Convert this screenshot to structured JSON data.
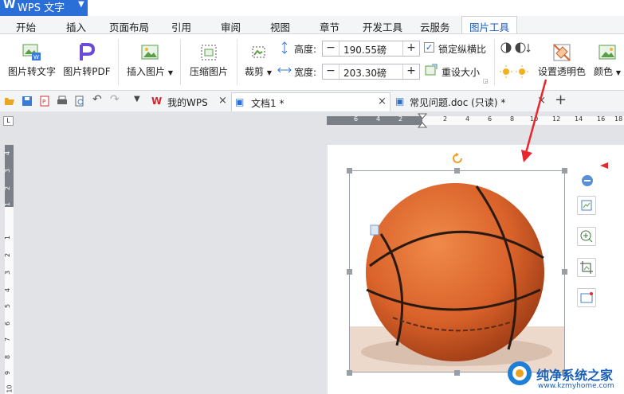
{
  "app": {
    "name": "WPS 文字"
  },
  "menu": {
    "tabs": [
      "开始",
      "插入",
      "页面布局",
      "引用",
      "审阅",
      "视图",
      "章节",
      "开发工具",
      "云服务"
    ],
    "active_tab": "图片工具"
  },
  "ribbon": {
    "pic_to_text": "图片转文字",
    "pic_to_pdf": "图片转PDF",
    "insert_pic": "插入图片",
    "compress": "压缩图片",
    "crop": "裁剪",
    "height_label": "高度:",
    "height_value": "190.55磅",
    "width_label": "宽度:",
    "width_value": "203.30磅",
    "lock_ratio": "锁定纵横比",
    "resize": "重设大小",
    "transparent": "设置透明色",
    "color": "颜色"
  },
  "doc_tabs": [
    {
      "label": "我的WPS"
    },
    {
      "label": "文档1 *"
    },
    {
      "label": "常见问题.doc (只读) *"
    }
  ],
  "ruler_h": [
    "6",
    "4",
    "2",
    "2",
    "4",
    "6",
    "8",
    "10",
    "12",
    "14",
    "16",
    "18"
  ],
  "ruler_v": [
    "4",
    "3",
    "2",
    "1",
    "1",
    "2",
    "3",
    "4",
    "5",
    "6",
    "7",
    "8",
    "9",
    "10"
  ],
  "watermark": {
    "title": "纯净系统之家",
    "url": "www.kzmyhome.com"
  },
  "colors": {
    "accent": "#2a6ed8",
    "ball": "#d9622a",
    "arrow": "#e8262f"
  }
}
